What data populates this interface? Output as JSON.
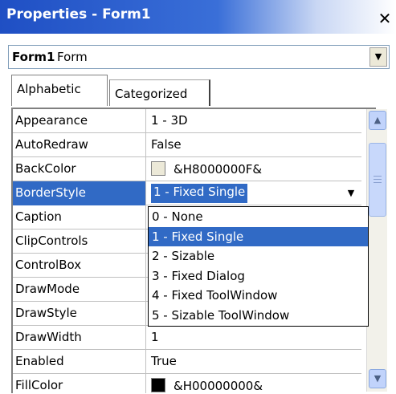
{
  "window": {
    "title": "Properties - Form1",
    "close_glyph": "✕"
  },
  "object_selector": {
    "name": "Form1",
    "type": "Form"
  },
  "tabs": [
    {
      "label": "Alphabetic"
    },
    {
      "label": "Categorized"
    }
  ],
  "properties": [
    {
      "name": "Appearance",
      "value": "1 - 3D"
    },
    {
      "name": "AutoRedraw",
      "value": "False"
    },
    {
      "name": "BackColor",
      "value": "&H8000000F&",
      "swatch": "#ece9d8"
    },
    {
      "name": "BorderStyle",
      "value": "1 - Fixed Single",
      "selected": true
    },
    {
      "name": "Caption",
      "value": ""
    },
    {
      "name": "ClipControls",
      "value": ""
    },
    {
      "name": "ControlBox",
      "value": ""
    },
    {
      "name": "DrawMode",
      "value": ""
    },
    {
      "name": "DrawStyle",
      "value": ""
    },
    {
      "name": "DrawWidth",
      "value": "1"
    },
    {
      "name": "Enabled",
      "value": "True"
    },
    {
      "name": "FillColor",
      "value": "&H00000000&",
      "swatch": "#000000"
    }
  ],
  "dropdown": {
    "options": [
      "0 - None",
      "1 - Fixed Single",
      "2 - Sizable",
      "3 - Fixed Dialog",
      "4 - Fixed ToolWindow",
      "5 - Sizable ToolWindow"
    ],
    "selected_index": 1
  },
  "colors": {
    "selection": "#316ac5",
    "title_gradient_start": "#1f4fc4"
  }
}
